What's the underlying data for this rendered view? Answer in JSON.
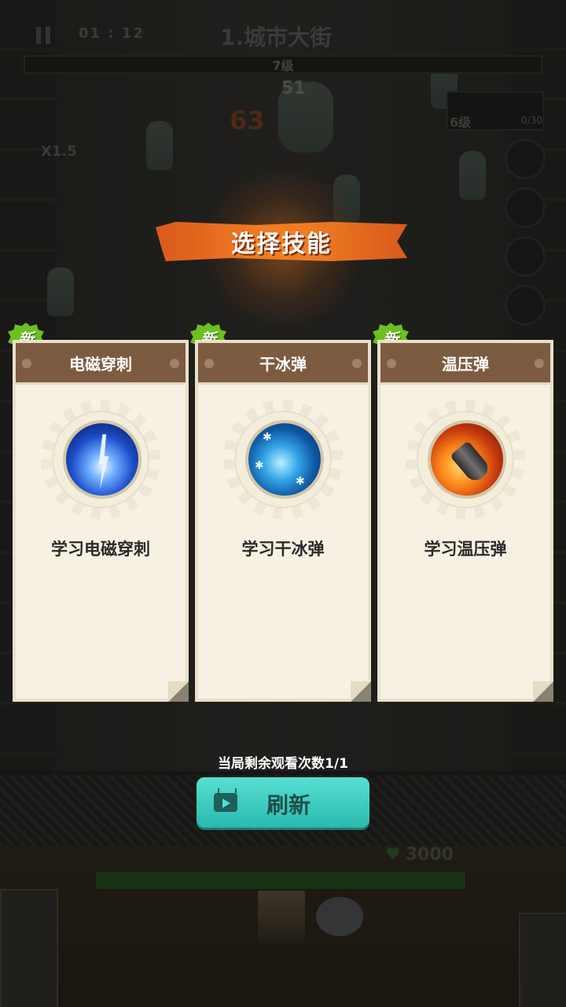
{
  "hud": {
    "timer": "01 : 12",
    "stage_title": "1.城市大街",
    "level": "7级",
    "damage_small": "51",
    "damage_big": "63",
    "multiplier": "X1.5",
    "panel_level": "6级",
    "panel_count": "0/30",
    "hp_value": "3000",
    "hp_fraction": 1.0
  },
  "banner": {
    "title": "选择技能"
  },
  "cards": [
    {
      "badge": "新",
      "name": "电磁穿刺",
      "action": "学习电磁穿刺",
      "icon": "electric-pierce-icon"
    },
    {
      "badge": "新",
      "name": "干冰弹",
      "action": "学习干冰弹",
      "icon": "dry-ice-bullet-icon"
    },
    {
      "badge": "新",
      "name": "温压弹",
      "action": "学习温压弹",
      "icon": "thermobaric-bullet-icon"
    }
  ],
  "footer": {
    "watch_left": "当局剩余观看次数1/1",
    "refresh_label": "刷新"
  },
  "colors": {
    "banner": "#f07a22",
    "card_header": "#7d5b40",
    "new_badge": "#6bbf1e",
    "refresh_button": "#2bb8ad"
  }
}
